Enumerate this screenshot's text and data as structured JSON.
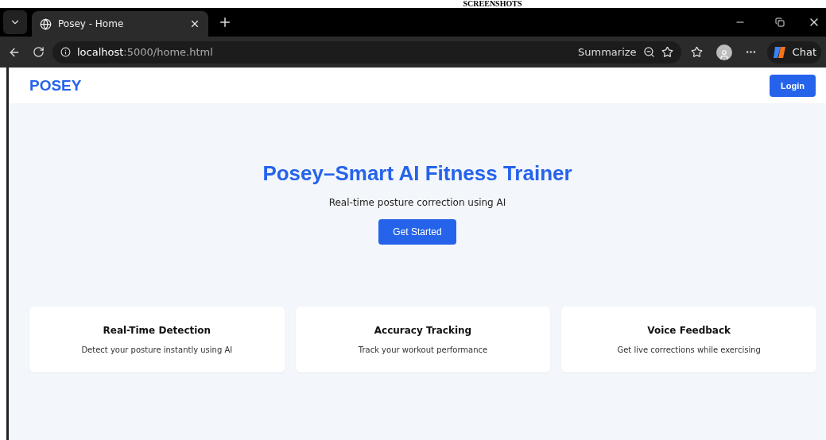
{
  "caption": "SCREENSHOTS",
  "browser": {
    "tabs": [
      {
        "title": "Posey - Home",
        "selected": true
      }
    ],
    "url_host": "localhost",
    "url_rest": ":5000/home.html",
    "summarize": "Summarize",
    "chat": "Chat"
  },
  "header": {
    "logo": "POSEY",
    "login": "Login"
  },
  "hero": {
    "title": "Posey–Smart AI Fitness Trainer",
    "subtitle": "Real-time posture correction using AI",
    "button": "Get Started"
  },
  "features": [
    {
      "title": "Real-Time Detection",
      "text": "Detect your posture instantly using AI"
    },
    {
      "title": "Accuracy Tracking",
      "text": "Track your workout performance"
    },
    {
      "title": "Voice Feedback",
      "text": "Get live corrections while exercising"
    }
  ]
}
